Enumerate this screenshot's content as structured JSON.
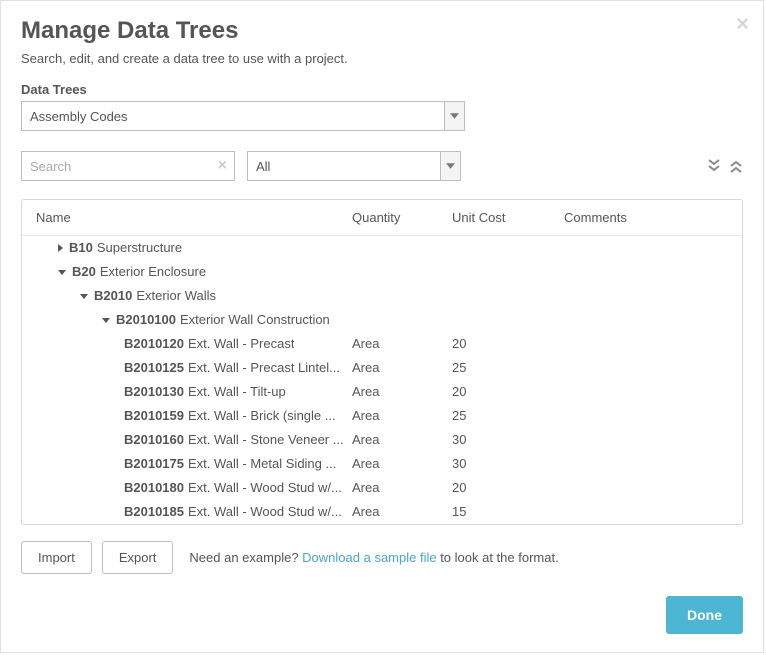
{
  "header": {
    "title": "Manage Data Trees",
    "subtitle": "Search, edit, and create a data tree to use with a project."
  },
  "data_trees": {
    "label": "Data Trees",
    "selected": "Assembly Codes"
  },
  "search": {
    "placeholder": "Search"
  },
  "filter": {
    "selected": "All"
  },
  "table": {
    "headers": {
      "name": "Name",
      "quantity": "Quantity",
      "unit_cost": "Unit Cost",
      "comments": "Comments"
    },
    "rows": [
      {
        "code": "B10",
        "label": "Superstructure",
        "indent": 1,
        "expanded": false,
        "has_children": true
      },
      {
        "code": "B20",
        "label": "Exterior Enclosure",
        "indent": 1,
        "expanded": true,
        "has_children": true
      },
      {
        "code": "B2010",
        "label": "Exterior Walls",
        "indent": 2,
        "expanded": true,
        "has_children": true
      },
      {
        "code": "B2010100",
        "label": "Exterior Wall Construction",
        "indent": 3,
        "expanded": true,
        "has_children": true
      },
      {
        "code": "B2010120",
        "label": "Ext. Wall - Precast",
        "indent": 4,
        "quantity": "Area",
        "unit_cost": "20"
      },
      {
        "code": "B2010125",
        "label": "Ext. Wall - Precast Lintel...",
        "indent": 4,
        "quantity": "Area",
        "unit_cost": "25"
      },
      {
        "code": "B2010130",
        "label": "Ext. Wall - Tilt-up",
        "indent": 4,
        "quantity": "Area",
        "unit_cost": "20"
      },
      {
        "code": "B2010159",
        "label": "Ext. Wall - Brick (single ...",
        "indent": 4,
        "quantity": "Area",
        "unit_cost": "25"
      },
      {
        "code": "B2010160",
        "label": "Ext. Wall - Stone Veneer ...",
        "indent": 4,
        "quantity": "Area",
        "unit_cost": "30"
      },
      {
        "code": "B2010175",
        "label": "Ext. Wall - Metal Siding ...",
        "indent": 4,
        "quantity": "Area",
        "unit_cost": "30"
      },
      {
        "code": "B2010180",
        "label": "Ext. Wall - Wood Stud w/...",
        "indent": 4,
        "quantity": "Area",
        "unit_cost": "20"
      },
      {
        "code": "B2010185",
        "label": "Ext. Wall - Wood Stud w/...",
        "indent": 4,
        "quantity": "Area",
        "unit_cost": "15"
      }
    ]
  },
  "footer": {
    "import_label": "Import",
    "export_label": "Export",
    "example_prefix": "Need an example? ",
    "example_link": "Download a sample file",
    "example_suffix": " to look at the format.",
    "done_label": "Done"
  }
}
